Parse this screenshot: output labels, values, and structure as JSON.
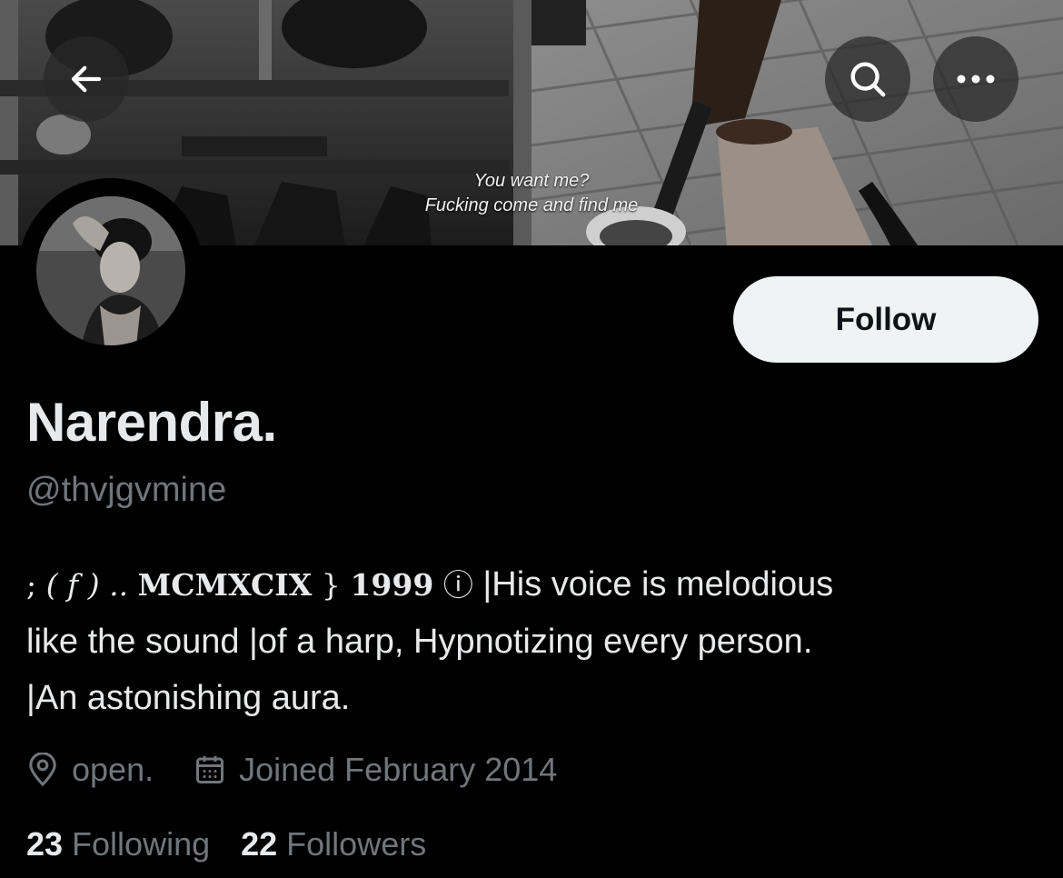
{
  "banner": {
    "caption_line1": "You want me?",
    "caption_line2": "Fucking come and find me"
  },
  "header": {
    "back_icon": "arrow-left-icon",
    "search_icon": "search-icon",
    "more_icon": "more-horizontal-icon"
  },
  "profile": {
    "follow_label": "Follow",
    "display_name": "Narendra.",
    "handle": "@thvjgvmine",
    "bio": {
      "part1": ";",
      "part2": "( f ) ..",
      "part3": "MCMXCIX",
      "part4": "}",
      "part5": "1999",
      "part6": "ⓘ",
      "part7": " |His voice is melodious",
      "line2": "like the sound |of a harp, Hypnotizing every person.",
      "line3": "|An astonishing aura."
    },
    "location": "open.",
    "location_icon": "location-pin-icon",
    "joined": "Joined February 2014",
    "joined_icon": "calendar-icon"
  },
  "stats": {
    "following_count": "23",
    "following_label": "Following",
    "followers_count": "22",
    "followers_label": "Followers"
  }
}
